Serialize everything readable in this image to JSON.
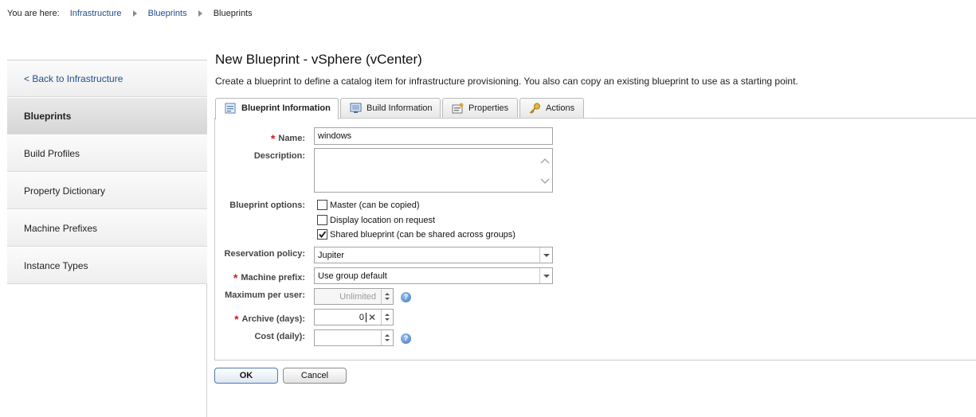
{
  "breadcrumb": {
    "prefix": "You are here:",
    "items": [
      "Infrastructure",
      "Blueprints",
      "Blueprints"
    ]
  },
  "sidebar": {
    "back_label": "< Back to Infrastructure",
    "items": [
      {
        "label": "Blueprints",
        "active": true
      },
      {
        "label": "Build Profiles",
        "active": false
      },
      {
        "label": "Property Dictionary",
        "active": false
      },
      {
        "label": "Machine Prefixes",
        "active": false
      },
      {
        "label": "Instance Types",
        "active": false
      }
    ]
  },
  "page": {
    "title": "New Blueprint - vSphere (vCenter)",
    "subtitle": "Create a blueprint to define a catalog item for infrastructure provisioning. You also can copy an existing blueprint to use as a starting point."
  },
  "tabs": [
    {
      "label": "Blueprint Information",
      "icon": "blueprint-info-icon",
      "active": true
    },
    {
      "label": "Build Information",
      "icon": "build-info-icon",
      "active": false
    },
    {
      "label": "Properties",
      "icon": "properties-icon",
      "active": false
    },
    {
      "label": "Actions",
      "icon": "key-icon",
      "active": false
    }
  ],
  "form": {
    "name": {
      "label": "Name:",
      "value": "windows",
      "required": true
    },
    "description": {
      "label": "Description:",
      "value": ""
    },
    "blueprint_options": {
      "label": "Blueprint options:",
      "options": [
        {
          "label": "Master (can be copied)",
          "checked": false
        },
        {
          "label": "Display location on request",
          "checked": false
        },
        {
          "label": "Shared blueprint (can be shared across groups)",
          "checked": true
        }
      ]
    },
    "reservation_policy": {
      "label": "Reservation policy:",
      "value": "Jupiter"
    },
    "machine_prefix": {
      "label": "Machine prefix:",
      "value": "Use group default",
      "required": true
    },
    "maximum_per_user": {
      "label": "Maximum per user:",
      "placeholder": "Unlimited"
    },
    "archive_days": {
      "label": "Archive (days):",
      "value": "0",
      "required": true
    },
    "cost_daily": {
      "label": "Cost (daily):",
      "value": ""
    }
  },
  "buttons": {
    "ok": "OK",
    "cancel": "Cancel"
  },
  "colors": {
    "link": "#1f4e8c",
    "required": "#d11919",
    "help": "#3a77c3"
  }
}
